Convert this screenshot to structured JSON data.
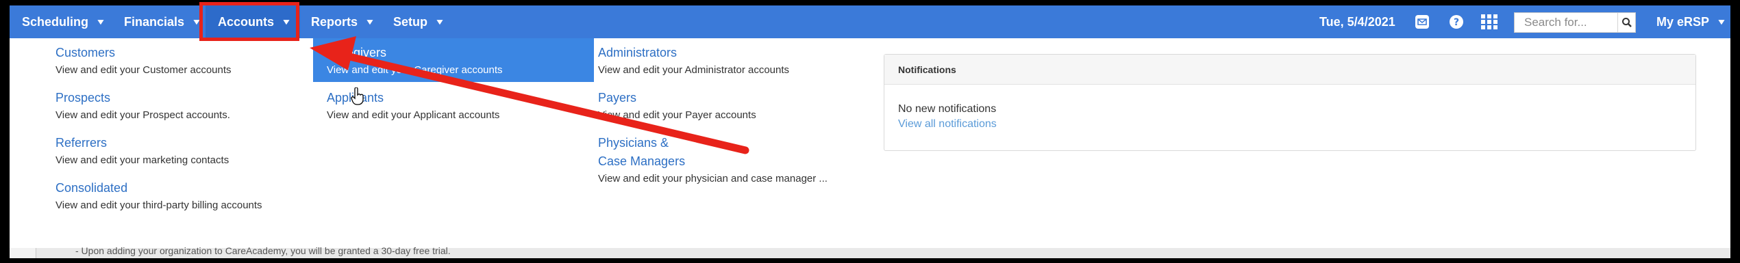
{
  "nav": {
    "items": [
      {
        "label": "Scheduling"
      },
      {
        "label": "Financials"
      },
      {
        "label": "Accounts"
      },
      {
        "label": "Reports"
      },
      {
        "label": "Setup"
      }
    ],
    "active": "Accounts",
    "date": "Tue, 5/4/2021",
    "search_placeholder": "Search for...",
    "user_label": "My eRSP",
    "icons": [
      "mail-icon",
      "help-icon",
      "apps-grid-icon",
      "search-icon",
      "chevron-down-icon"
    ]
  },
  "accounts_menu": {
    "col1": [
      {
        "title": "Customers",
        "desc": "View and edit your Customer accounts"
      },
      {
        "title": "Prospects",
        "desc": "View and edit your Prospect accounts."
      },
      {
        "title": "Referrers",
        "desc": "View and edit your marketing contacts"
      },
      {
        "title": "Consolidated",
        "desc": "View and edit your third-party billing accounts"
      }
    ],
    "col2": [
      {
        "title": "Caregivers",
        "desc": "View and edit your Caregiver accounts"
      },
      {
        "title": "Applicants",
        "desc": "View and edit your Applicant accounts"
      }
    ],
    "col3": [
      {
        "title": "Administrators",
        "desc": "View and edit your Administrator accounts"
      },
      {
        "title": "Payers",
        "desc": "View and edit your Payer accounts"
      },
      {
        "title_line1": "Physicians &",
        "title_line2": "Case Managers",
        "desc": "View and edit your physician and case manager ..."
      }
    ]
  },
  "notifications": {
    "heading": "Notifications",
    "empty": "No new notifications",
    "link": "View all notifications"
  },
  "background_text": "- Upon adding your organization to CareAcademy, you will be granted a 30-day free trial.",
  "colors": {
    "nav_bg": "#3b7ad9",
    "selected_bg": "#3b86e3",
    "link": "#2d6fc4",
    "annotation_red": "#e8231a"
  }
}
